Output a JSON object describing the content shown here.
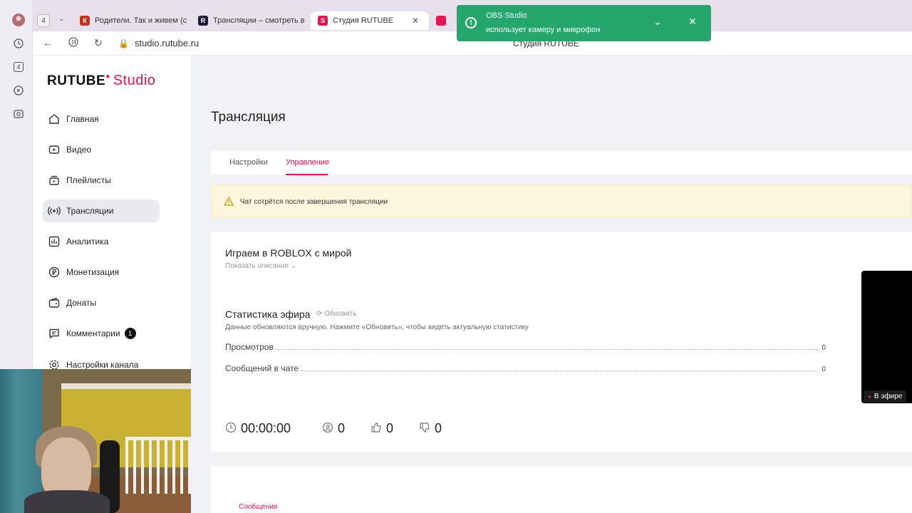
{
  "browser": {
    "tab_counter": "4",
    "left_panel": {
      "counter": "4"
    },
    "tabs": [
      {
        "label": "Родители. Так и живем (с",
        "favicon": "К"
      },
      {
        "label": "Трансляции – смотреть в",
        "favicon": "R"
      },
      {
        "label": "Студия RUTUBE",
        "favicon": "S",
        "active": true
      }
    ],
    "url": "studio.rutube.ru",
    "page_title": "Студия RUTUBE"
  },
  "notification": {
    "title": "OBS Studio",
    "text": "использует камеру и микрофон",
    "color": "#25a66c"
  },
  "sidebar": {
    "logo_main": "RUTUBE",
    "logo_studio": "Studio",
    "items": [
      {
        "label": "Главная",
        "icon": "home-icon"
      },
      {
        "label": "Видео",
        "icon": "video-icon"
      },
      {
        "label": "Плейлисты",
        "icon": "playlist-icon"
      },
      {
        "label": "Трансляции",
        "icon": "broadcast-icon",
        "active": true
      },
      {
        "label": "Аналитика",
        "icon": "analytics-icon"
      },
      {
        "label": "Монетизация",
        "icon": "ruble-icon"
      },
      {
        "label": "Донаты",
        "icon": "wallet-icon"
      },
      {
        "label": "Комментарии",
        "icon": "comment-icon",
        "badge": "1"
      },
      {
        "label": "Настройки канала",
        "icon": "gear-icon"
      }
    ]
  },
  "main": {
    "title": "Трансляция",
    "tabs": [
      {
        "label": "Настройки"
      },
      {
        "label": "Управление",
        "active": true
      }
    ],
    "warning": "Чат сотрётся после завершения трансляции",
    "stream_title": "Играем в ROBLOX с мирой",
    "show_description": "Показать описание",
    "stats": {
      "title": "Статистика эфира",
      "refresh": "Обновить",
      "hint": "Данные обновляются вручную. Нажмите «Обновить», чтобы видеть актуальную статистику",
      "rows": [
        {
          "label": "Просмотров",
          "value": "0"
        },
        {
          "label": "Сообщений в чате",
          "value": "0"
        }
      ]
    },
    "metrics": {
      "duration": "00:00:00",
      "viewers": "0",
      "likes": "0",
      "dislikes": "0"
    },
    "live_label": "В эфире",
    "messages_tab": "Сообщения"
  },
  "colors": {
    "accent": "#e6154f",
    "warning_bg": "#fdf6dd",
    "page_bg": "#f1f2f5"
  }
}
